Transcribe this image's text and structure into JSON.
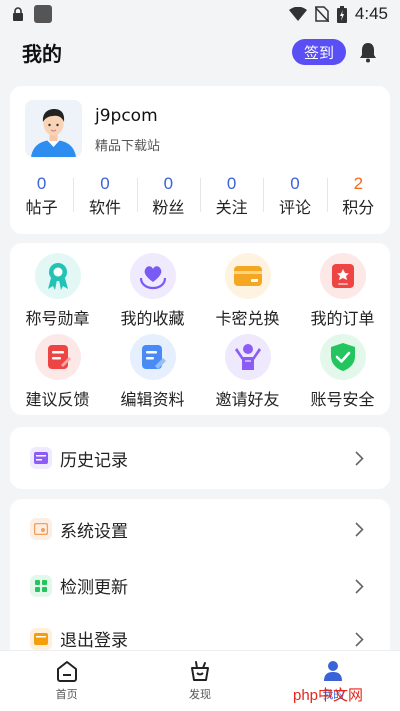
{
  "status_bar": {
    "time": "4:45"
  },
  "header": {
    "title": "我的",
    "signin_label": "签到"
  },
  "profile": {
    "username": "j9pcom",
    "subtitle": "精品下载站"
  },
  "stats": [
    {
      "value": "0",
      "label": "帖子"
    },
    {
      "value": "0",
      "label": "软件"
    },
    {
      "value": "0",
      "label": "粉丝"
    },
    {
      "value": "0",
      "label": "关注"
    },
    {
      "value": "0",
      "label": "评论"
    },
    {
      "value": "2",
      "label": "积分"
    }
  ],
  "grid": [
    {
      "label": "称号勋章",
      "icon": "medal-icon",
      "color": "#22c3b5"
    },
    {
      "label": "我的收藏",
      "icon": "heart-hand-icon",
      "color": "#7a5af5"
    },
    {
      "label": "卡密兑换",
      "icon": "card-icon",
      "color": "#f5a623"
    },
    {
      "label": "我的订单",
      "icon": "order-icon",
      "color": "#ef4444"
    },
    {
      "label": "建议反馈",
      "icon": "feedback-icon",
      "color": "#ef4444"
    },
    {
      "label": "编辑资料",
      "icon": "edit-profile-icon",
      "color": "#4a8af4"
    },
    {
      "label": "邀请好友",
      "icon": "invite-icon",
      "color": "#8b5cf6"
    },
    {
      "label": "账号安全",
      "icon": "shield-check-icon",
      "color": "#22c55e"
    }
  ],
  "history": {
    "label": "历史记录",
    "icon": "history-icon",
    "color": "#8b5cf6"
  },
  "settings_rows": [
    {
      "label": "系统设置",
      "icon": "settings-icon",
      "color": "#f5a05a"
    },
    {
      "label": "检测更新",
      "icon": "update-icon",
      "color": "#22c55e"
    },
    {
      "label": "退出登录",
      "icon": "logout-icon",
      "color": "#f59e0b"
    }
  ],
  "bottom_nav": [
    {
      "label": "首页",
      "icon": "home-icon"
    },
    {
      "label": "发现",
      "icon": "discover-icon"
    },
    {
      "label": "我的",
      "icon": "profile-icon",
      "active": true
    }
  ],
  "watermark": "php中文网",
  "colors": {
    "accent": "#5a4ef5",
    "stat_blue": "#3a63d8",
    "stat_orange": "#f26b1d",
    "watermark_red": "#e3261a"
  }
}
